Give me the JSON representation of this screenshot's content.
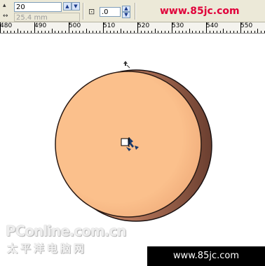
{
  "toolbar": {
    "outline_width": "20",
    "size_value": "25.4 mm",
    "offset_value": ".0",
    "watermark": "www.85jc.com"
  },
  "ruler": {
    "labels": [
      "480",
      "490",
      "500",
      "510",
      "520",
      "530",
      "540",
      "550"
    ]
  },
  "branding": {
    "logo_text": "PConline.com.cn",
    "logo_sub": "太平洋电脑网",
    "bottom_url": "www.85jc.com"
  },
  "colors": {
    "circle_fill": "#fbc08c",
    "circle_shadow": "#7a4a38",
    "watermark_red": "#e0003a"
  },
  "icons": [
    "outline-width-icon",
    "size-icon",
    "offset-icon",
    "extrude-cursor-icon",
    "vanishing-point-icon"
  ]
}
